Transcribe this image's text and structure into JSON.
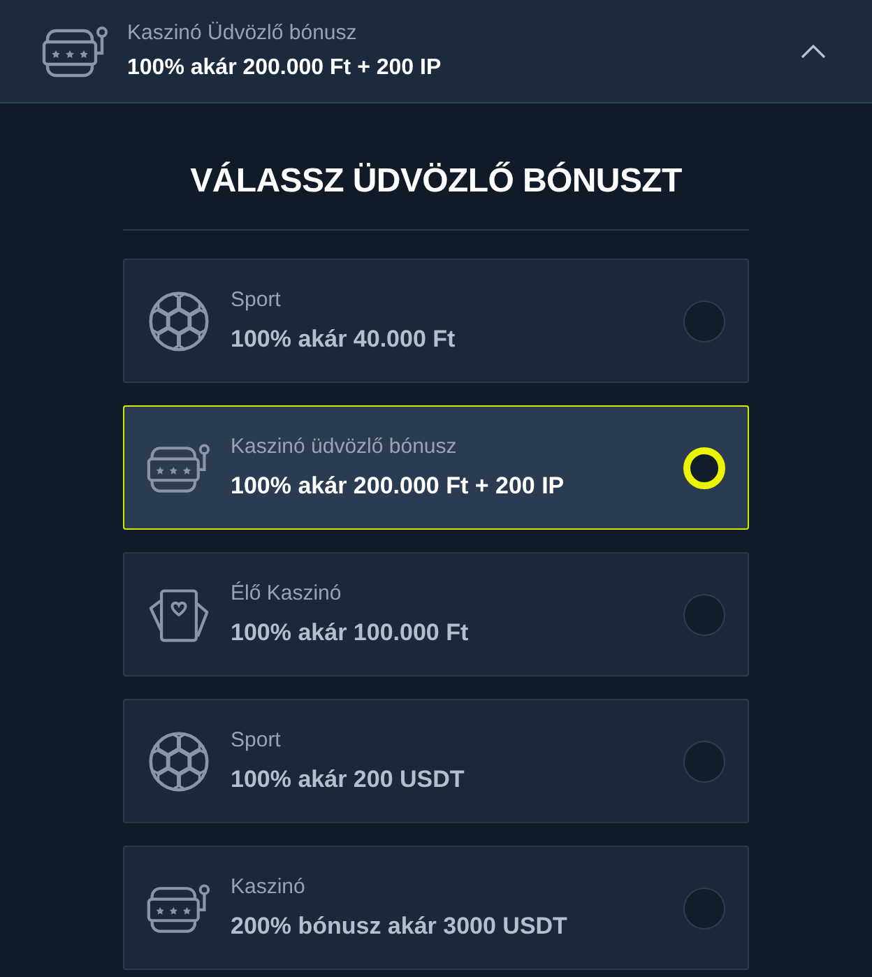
{
  "header": {
    "kind": "casino",
    "label": "Kaszinó Üdvözlő bónusz",
    "value": "100% akár 200.000 Ft + 200 IP",
    "expanded": true
  },
  "title": "VÁLASSZ ÜDVÖZLŐ BÓNUSZT",
  "options": [
    {
      "kind": "sport",
      "label": "Sport",
      "value": "100% akár 40.000 Ft",
      "selected": false
    },
    {
      "kind": "casino",
      "label": "Kaszinó üdvözlő bónusz",
      "value": "100% akár 200.000 Ft + 200 IP",
      "selected": true
    },
    {
      "kind": "live",
      "label": "Élő Kaszinó",
      "value": "100% akár 100.000 Ft",
      "selected": false
    },
    {
      "kind": "sport",
      "label": "Sport",
      "value": "100% akár 200 USDT",
      "selected": false
    },
    {
      "kind": "casino",
      "label": "Kaszinó",
      "value": "200% bónusz akár 3000 USDT",
      "selected": false
    }
  ]
}
